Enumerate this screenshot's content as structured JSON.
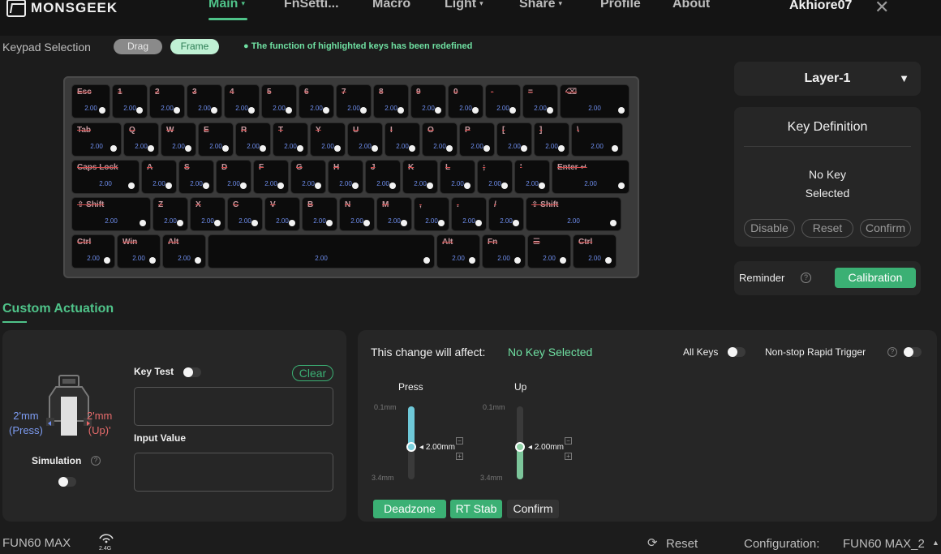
{
  "app": {
    "logo_text": "MONSGEEK",
    "user": "Akhiore07"
  },
  "nav": {
    "items": [
      {
        "label": "Main",
        "caret": "▾",
        "active": true
      },
      {
        "label": "FnSetti...",
        "caret": ""
      },
      {
        "label": "Macro",
        "caret": ""
      },
      {
        "label": "Light",
        "caret": "▾"
      },
      {
        "label": "Share",
        "caret": "▾"
      },
      {
        "label": "Profile",
        "caret": ""
      },
      {
        "label": "About",
        "caret": ""
      }
    ]
  },
  "keypad": {
    "label": "Keypad Selection",
    "drag": "Drag",
    "frame": "Frame",
    "notice": "● The function of highlighted keys has been redefined"
  },
  "keyboard": {
    "rows": [
      [
        [
          "Esc",
          "2.00",
          48
        ],
        [
          "1",
          "2.00",
          44
        ],
        [
          "2",
          "2.00",
          44
        ],
        [
          "3",
          "2.00",
          44
        ],
        [
          "4",
          "2.00",
          44
        ],
        [
          "5",
          "2.00",
          44
        ],
        [
          "6",
          "2.00",
          44
        ],
        [
          "7",
          "2.00",
          44
        ],
        [
          "8",
          "2.00",
          44
        ],
        [
          "9",
          "2.00",
          44
        ],
        [
          "0",
          "2.00",
          44
        ],
        [
          "-",
          "2.00",
          44
        ],
        [
          "=",
          "2.00",
          44
        ],
        [
          "⌫",
          "2.00",
          86
        ]
      ],
      [
        [
          "Tab",
          "2.00",
          62
        ],
        [
          "Q",
          "2.00",
          44
        ],
        [
          "W",
          "2.00",
          44
        ],
        [
          "E",
          "2.00",
          44
        ],
        [
          "R",
          "2.00",
          44
        ],
        [
          "T",
          "2.00",
          44
        ],
        [
          "Y",
          "2.00",
          44
        ],
        [
          "U",
          "2.00",
          44
        ],
        [
          "I",
          "2.00",
          44
        ],
        [
          "O",
          "2.00",
          44
        ],
        [
          "P",
          "2.00",
          44
        ],
        [
          "[",
          "2.00",
          44
        ],
        [
          "]",
          "2.00",
          44
        ],
        [
          "\\",
          "2.00",
          64
        ]
      ],
      [
        [
          "Caps Lock",
          "2.00",
          84
        ],
        [
          "A",
          "2.00",
          44
        ],
        [
          "S",
          "2.00",
          44
        ],
        [
          "D",
          "2.00",
          44
        ],
        [
          "F",
          "2.00",
          44
        ],
        [
          "G",
          "2.00",
          44
        ],
        [
          "H",
          "2.00",
          44
        ],
        [
          "J",
          "2.00",
          44
        ],
        [
          "K",
          "2.00",
          44
        ],
        [
          "L",
          "2.00",
          44
        ],
        [
          ";",
          "2.00",
          44
        ],
        [
          "'",
          "2.00",
          44
        ],
        [
          "Enter ↵",
          "2.00",
          96
        ]
      ],
      [
        [
          "⇧ Shift",
          "2.00",
          98
        ],
        [
          "Z",
          "2.00",
          44
        ],
        [
          "X",
          "2.00",
          44
        ],
        [
          "C",
          "2.00",
          44
        ],
        [
          "V",
          "2.00",
          44
        ],
        [
          "B",
          "2.00",
          44
        ],
        [
          "N",
          "2.00",
          44
        ],
        [
          "M",
          "2.00",
          44
        ],
        [
          ",",
          "2.00",
          44
        ],
        [
          ".",
          "2.00",
          44
        ],
        [
          "/",
          "2.00",
          44
        ],
        [
          "⇧ Shift",
          "2.00",
          118
        ]
      ],
      [
        [
          "Ctrl",
          "2.00",
          54
        ],
        [
          "Win",
          "2.00",
          54
        ],
        [
          "Alt",
          "2.00",
          54
        ],
        [
          "",
          "2.00",
          280
        ],
        [
          "Alt",
          "2.00",
          54
        ],
        [
          "Fn",
          "2.00",
          54
        ],
        [
          "☰",
          "2.00",
          54
        ],
        [
          "Ctrl",
          "2.00",
          54
        ]
      ]
    ]
  },
  "layer": {
    "label": "Layer-1",
    "arrow": "▼"
  },
  "key_definition": {
    "title": "Key Definition",
    "empty_line1": "No Key",
    "empty_line2": "Selected",
    "disable": "Disable",
    "reset": "Reset",
    "confirm": "Confirm"
  },
  "reminder": {
    "label": "Reminder",
    "help": "?",
    "calibration": "Calibration"
  },
  "custom_actuation": {
    "title": "Custom Actuation",
    "switch_left_val": "2'mm",
    "switch_left_lbl": "(Press)",
    "switch_right_val": "2'mm",
    "switch_right_lbl": "(Up)'",
    "simulation": "Simulation",
    "key_test": "Key Test",
    "clear": "Clear",
    "input_value": "Input Value"
  },
  "affect": {
    "label": "This change will affect:",
    "value": "No Key Selected",
    "all_keys": "All Keys",
    "rapid": "Non-stop Rapid Trigger",
    "help": "?"
  },
  "press": {
    "label": "Press",
    "min": "0.1mm",
    "max": "3.4mm",
    "value": "2.00mm",
    "level": 0.56
  },
  "up": {
    "label": "Up",
    "min": "0.1mm",
    "max": "3.4mm",
    "value": "2.00mm",
    "level": 0.56
  },
  "actions": {
    "deadzone": "Deadzone",
    "rt_stab": "RT Stab",
    "confirm": "Confirm"
  },
  "footer": {
    "device": "FUN60 MAX",
    "wireless": "2.4G",
    "reset": "Reset",
    "config_label": "Configuration:",
    "config_value": "FUN60 MAX_2",
    "config_caret": "▲"
  },
  "colors": {
    "accent": "#4fc389",
    "button_green": "#3bb074",
    "key_value": "#6f8ff0",
    "legend_strike": "#d24a4a"
  }
}
